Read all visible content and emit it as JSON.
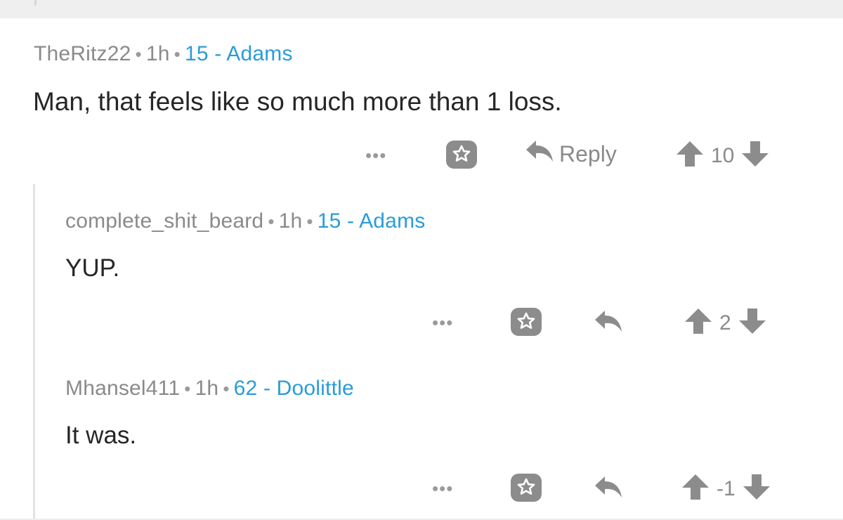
{
  "comments": [
    {
      "username": "TheRitz22",
      "separator": "•",
      "time": "1h",
      "flair": "15 - Adams",
      "text": "Man, that feels like so much more than 1 loss.",
      "more": "•••",
      "reply_label": "Reply",
      "score": "10"
    },
    {
      "username": "complete_shit_beard",
      "separator": "•",
      "time": "1h",
      "flair": "15 - Adams",
      "text": "YUP.",
      "more": "•••",
      "score": "2"
    },
    {
      "username": "Mhansel411",
      "separator": "•",
      "time": "1h",
      "flair": "62 - Doolittle",
      "text": "It was.",
      "more": "•••",
      "score": "-1"
    }
  ],
  "colors": {
    "meta": "#8a8a8a",
    "flair": "#2a9cd8",
    "text": "#262626",
    "icon": "#8c8c8c",
    "thread_line": "#e3e3e3"
  },
  "icons": [
    "award-icon",
    "reply-icon",
    "upvote-icon",
    "downvote-icon"
  ]
}
